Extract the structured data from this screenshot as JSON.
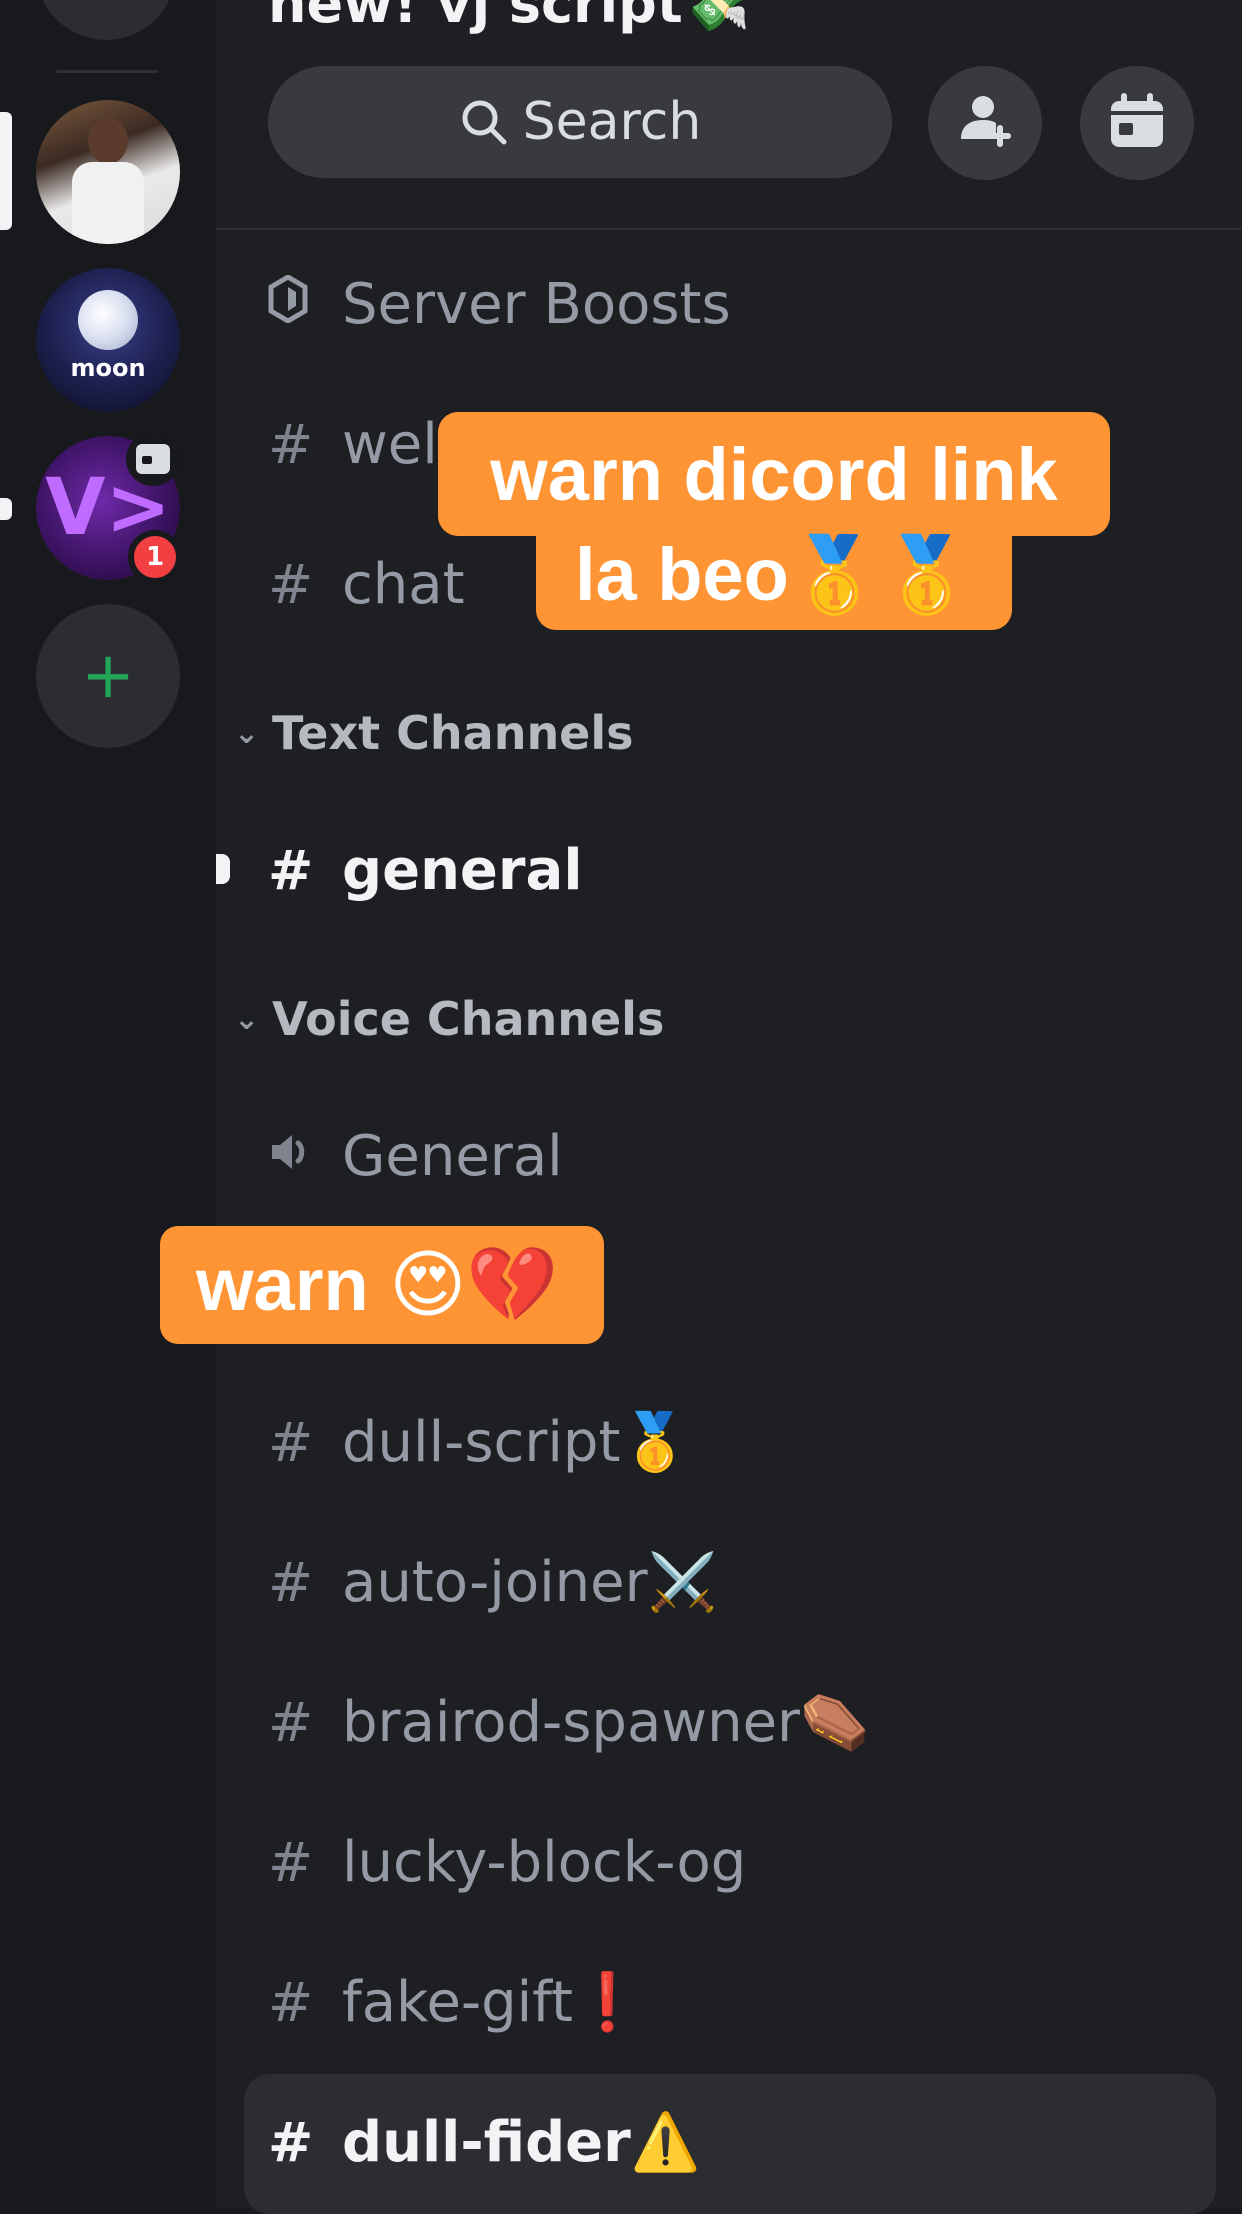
{
  "server": {
    "title": "new! vj script💸"
  },
  "rail": {
    "servers": [
      {
        "name": "profile-server"
      },
      {
        "name": "moon",
        "label": "moon"
      },
      {
        "name": "vj-server",
        "label": "V>",
        "badge_count": "1"
      }
    ],
    "add_server_symbol": "+"
  },
  "header": {
    "search_label": "Search",
    "invite_icon": "add-user-icon",
    "events_icon": "calendar-icon"
  },
  "channels": {
    "boosts": "Server Boosts",
    "welcome": "wel",
    "chat": "chat",
    "hash": "#",
    "categories": {
      "text": "Text Channels",
      "voice": "Voice Channels"
    },
    "general_text": "general",
    "general_voice": "General",
    "list": [
      "dull-script🥇",
      "auto-joiner⚔️",
      "brairod-spawner⚰️",
      "lucky-block-og",
      "fake-gift❗",
      "dull-fider⚠️"
    ]
  },
  "captions": {
    "line1": "warn dicord link",
    "line2": "la beo🥇🥇",
    "warn": "warn 😍💔"
  },
  "colors": {
    "caption_bg": "#ff9434",
    "unread_badge": "#f23f42",
    "add_server": "#23a55a"
  }
}
